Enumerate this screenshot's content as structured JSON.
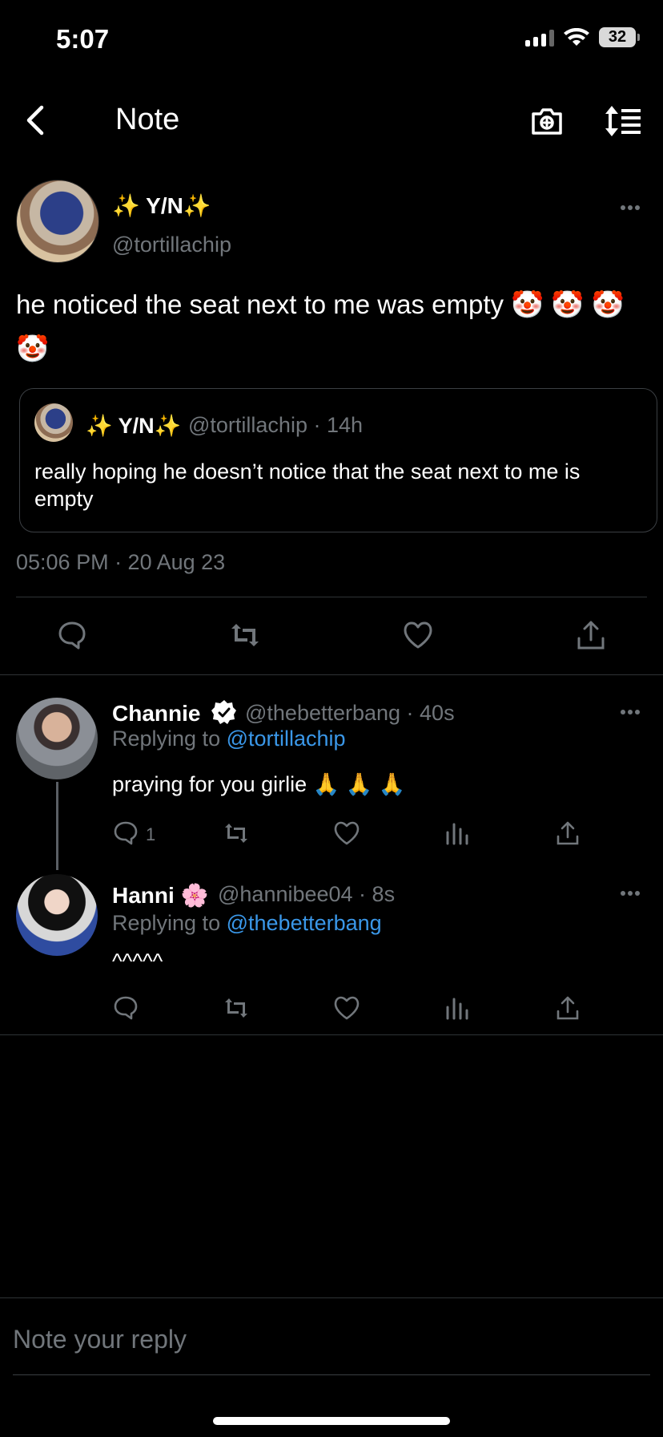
{
  "status_bar": {
    "time": "5:07",
    "battery": "32"
  },
  "header": {
    "title": "Note"
  },
  "post": {
    "author_name": "✨ Y/N✨",
    "author_handle": "@tortillachip",
    "text": "he noticed the seat next to me was empty 🤡 🤡 🤡 🤡",
    "timestamp": "05:06 PM · 20 Aug 23",
    "quoted": {
      "author_name": "✨ Y/N✨",
      "author_handle_time": "@tortillachip · 14h",
      "text": "really hoping he doesn’t notice that the seat next to me is empty"
    }
  },
  "replies": [
    {
      "author_name": "Channie",
      "handle_time": "@thebetterbang · 40s",
      "replying_prefix": "Replying to",
      "replying_to": "@tortillachip",
      "text": "praying for you girlie 🙏 🙏 🙏",
      "reply_count": "1"
    },
    {
      "author_name": "Hanni 🌸",
      "handle_time": "@hannibee04 · 8s",
      "replying_prefix": "Replying to",
      "replying_to": "@thebetterbang",
      "text": "^^^^^"
    }
  ],
  "reply_input": {
    "placeholder": "Note your reply"
  },
  "colors": {
    "background": "#000000",
    "muted": "#71767b",
    "link": "#3a97e8",
    "divider": "#2f3336"
  },
  "icons": {
    "back": "chevron-left-icon",
    "camera": "camera-plus-icon",
    "sort": "sort-timeline-icon",
    "more": "more-horizontal-icon",
    "reply": "reply-icon",
    "retweet": "retweet-icon",
    "like": "heart-icon",
    "share": "share-icon",
    "stats": "stats-icon",
    "verified": "verified-badge-icon"
  }
}
